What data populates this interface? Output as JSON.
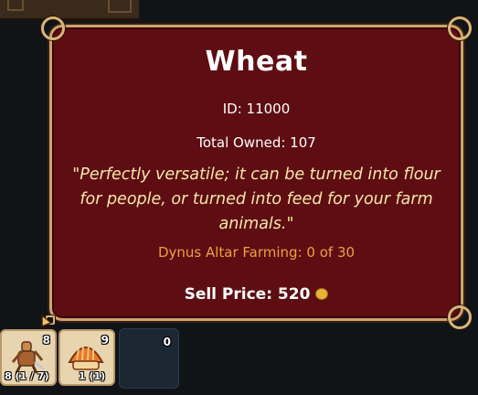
{
  "tooltip": {
    "title": "Wheat",
    "id_line": "ID: 11000",
    "owned_line": "Total Owned: 107",
    "description": "\"Perfectly versatile; it can be turned into flour for people, or turned into feed for your farm animals.\"",
    "altar_line": "Dynus Altar Farming: 0 of 30",
    "sell_price": "Sell Price: 520"
  },
  "inventory": {
    "slot1": {
      "icon": "harvest-figure-icon",
      "qty": "8",
      "sub": "8 (1 / 7)"
    },
    "slot2": {
      "icon": "mushroom-shell-icon",
      "qty": "9",
      "sub": "1 (1)"
    },
    "slot3": {
      "qty": "0"
    }
  },
  "colors": {
    "panel": "#5e0d12",
    "border": "#c9a46e",
    "description": "#f6e7a8",
    "altar": "#f0a040"
  }
}
